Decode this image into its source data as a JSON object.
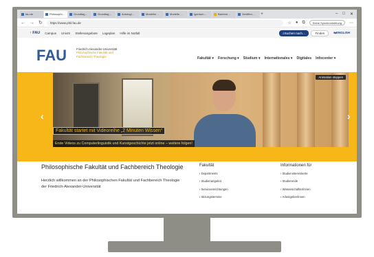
{
  "browser": {
    "tabs": [
      "fau.de",
      "Philosophi…",
      "Grundlag…",
      "Grundlag…",
      "Autologi…",
      "Modellm…",
      "Modelle…",
      "Igentum…",
      "Barriere…",
      "Veröffen…"
    ],
    "url": "https://www.phil.fau.de",
    "sync_label": "Keine Synchronisierung"
  },
  "metabar": {
    "home": "FAU",
    "links": [
      "Campus",
      "UnivIS",
      "Stellenangebote",
      "Lageplan",
      "Hilfe im Notfall"
    ],
    "search_label": "Suchen nach…",
    "find_label": "Finden",
    "lang_label": "ENGLISH"
  },
  "logo": {
    "mark": "FAU",
    "line1": "Friedrich-Alexander-Universität",
    "line2": "Philosophische Fakultät und",
    "line3": "Fachbereich Theologie"
  },
  "nav": [
    "Fakultät ▾",
    "Forschung ▾",
    "Studium ▾",
    "Internationales ▾",
    "Digitales",
    "Infocenter ▾"
  ],
  "hero": {
    "anim_button": "Animation stoppen",
    "title": "Fakultät startet mit Videoreihe „2 Minuten Wissen“",
    "subtitle": "Erste Videos zu Computerlinguistik und Kunstgeschichte jetzt online – weitere folgen!"
  },
  "intro": {
    "heading": "Philosophische Fakultät und Fachbereich Theologie",
    "text": "Herzlich willkommen an der Philosophischen Fakultät und Fachbereich Theologie der Friedrich-Alexander-Universität"
  },
  "fakultaet": {
    "heading": "Fakultät",
    "items": [
      "Departments",
      "Studienangebot",
      "Serviceeinrichtungen",
      "Sitzungstermine"
    ]
  },
  "info": {
    "heading": "Informationen für",
    "items": [
      "Studieninteressierte",
      "Studierende",
      "Wissenschaftler/innen",
      "Arbeitgeber/innen"
    ]
  }
}
